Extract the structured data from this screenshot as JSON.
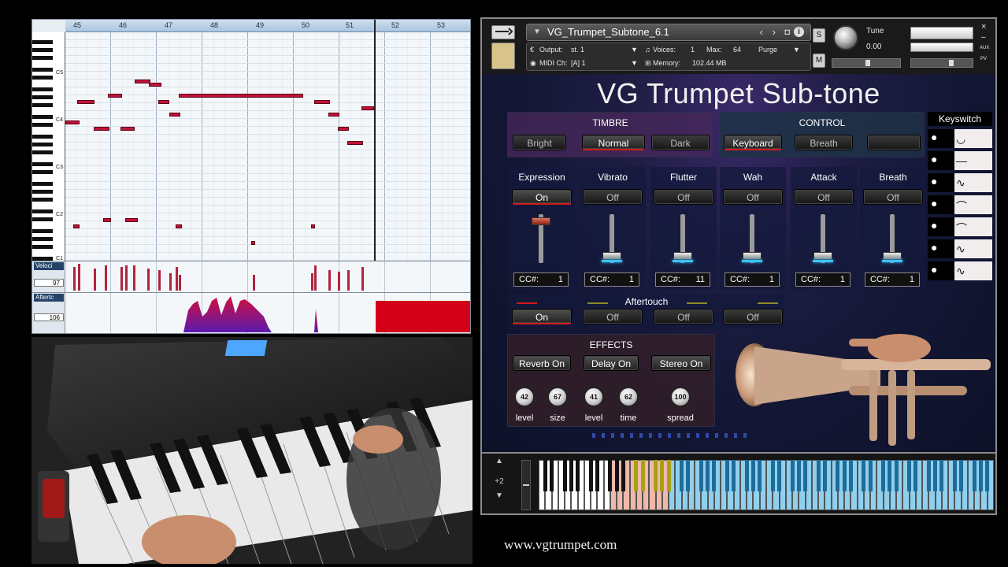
{
  "piano_roll": {
    "bars": [
      "45",
      "46",
      "47",
      "48",
      "49",
      "50",
      "51",
      "52",
      "53"
    ],
    "octave_labels": [
      "C5",
      "C4",
      "C3",
      "C2",
      "C1"
    ],
    "velocity_lane": {
      "label": "Veloci",
      "value": "97"
    },
    "aftertouch_lane": {
      "label": "Aftertc",
      "value": "106"
    }
  },
  "kontakt": {
    "instrument_name": "VG_Trumpet_Subtone_6.1",
    "output_label": "Output:",
    "output_value": "st. 1",
    "voices_label": "Voices:",
    "voices_value": "1",
    "max_label": "Max:",
    "max_value": "64",
    "purge_label": "Purge",
    "midi_label": "MIDI Ch:",
    "midi_value": "[A]  1",
    "memory_label": "Memory:",
    "memory_value": "102.44 MB",
    "s_label": "S",
    "m_label": "M",
    "tune_label": "Tune",
    "tune_value": "0.00",
    "aux_label": "AUX",
    "pv_label": "PV",
    "close_glyph": "×",
    "min_glyph": "–",
    "title": "VG Trumpet Sub-tone",
    "timbre": {
      "title": "TIMBRE",
      "buttons": [
        "Bright",
        "Normal",
        "Dark"
      ]
    },
    "control": {
      "title": "CONTROL",
      "buttons": [
        "Keyboard",
        "Breath"
      ]
    },
    "keyswitch_title": "Keyswitch",
    "columns": [
      {
        "name": "Expression",
        "state": "On",
        "cc": "1",
        "fader": 0.95
      },
      {
        "name": "Vibrato",
        "state": "Off",
        "cc": "1",
        "fader": 0.0
      },
      {
        "name": "Flutter",
        "state": "Off",
        "cc": "11",
        "fader": 0.0
      },
      {
        "name": "Wah",
        "state": "Off",
        "cc": "1",
        "fader": 0.0
      },
      {
        "name": "Attack",
        "state": "Off",
        "cc": "1",
        "fader": 0.0
      },
      {
        "name": "Breath",
        "state": "Off",
        "cc": "1",
        "fader": 0.0
      }
    ],
    "cc_prefix": "CC#:",
    "aftertouch": {
      "title": "Aftertouch",
      "buttons": [
        "On",
        "Off",
        "Off",
        "Off"
      ]
    },
    "effects": {
      "title": "EFFECTS",
      "buttons": [
        "Reverb On",
        "Delay On",
        "Stereo On"
      ],
      "knobs": [
        {
          "value": "42",
          "label": "level"
        },
        {
          "value": "67",
          "label": "size"
        },
        {
          "value": "41",
          "label": "level"
        },
        {
          "value": "62",
          "label": "time"
        },
        {
          "value": "100",
          "label": "spread"
        }
      ]
    }
  },
  "keyboard": {
    "octave_shift": "+2",
    "up_glyph": "▲",
    "down_glyph": "▼"
  },
  "website": "www.vgtrumpet.com",
  "colors": {
    "accent_red": "#d01a1a",
    "note_red": "#c0123a",
    "key_blue": "#8fd0ee",
    "glow_blue": "#3cc3ff"
  }
}
